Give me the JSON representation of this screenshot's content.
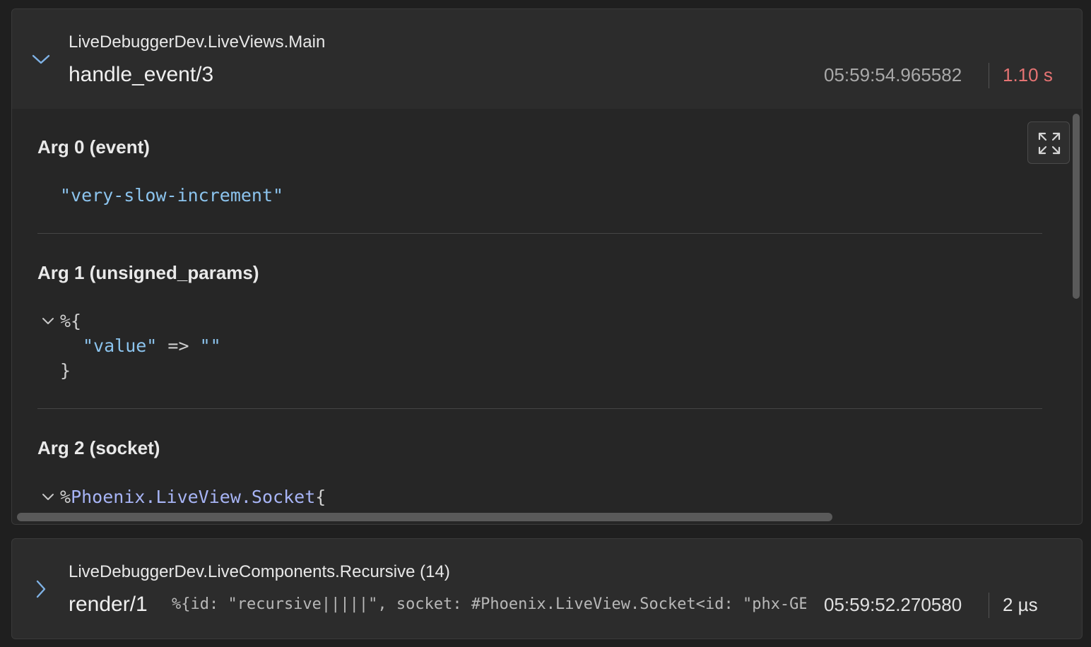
{
  "traces": [
    {
      "expanded": true,
      "module": "LiveDebuggerDev.LiveViews.Main",
      "function": "handle_event/3",
      "timestamp": "05:59:54.965582",
      "duration": "1.10 s",
      "duration_color": "#e57373",
      "args": [
        {
          "title": "Arg 0 (event)",
          "value": "\"very-slow-increment\""
        },
        {
          "title": "Arg 1 (unsigned_params)",
          "open": "%{",
          "key": "\"value\"",
          "arrow": "=>",
          "val": "\"\"",
          "close": "}"
        },
        {
          "title": "Arg 2 (socket)",
          "prefix": "%",
          "struct": "Phoenix.LiveView.Socket",
          "open": "{"
        }
      ]
    },
    {
      "expanded": false,
      "module": "LiveDebuggerDev.LiveComponents.Recursive (14)",
      "function": "render/1",
      "args_preview": "%{id: \"recursive|||||\", socket: #Phoenix.LiveView.Socket<id: \"phx-GE",
      "timestamp": "05:59:52.270580",
      "duration": "2 µs",
      "duration_color": "#e6e6e6"
    }
  ],
  "icons": {
    "collapse": "chevron-down-icon",
    "expand": "chevron-right-icon",
    "fullscreen": "fullscreen-icon"
  }
}
